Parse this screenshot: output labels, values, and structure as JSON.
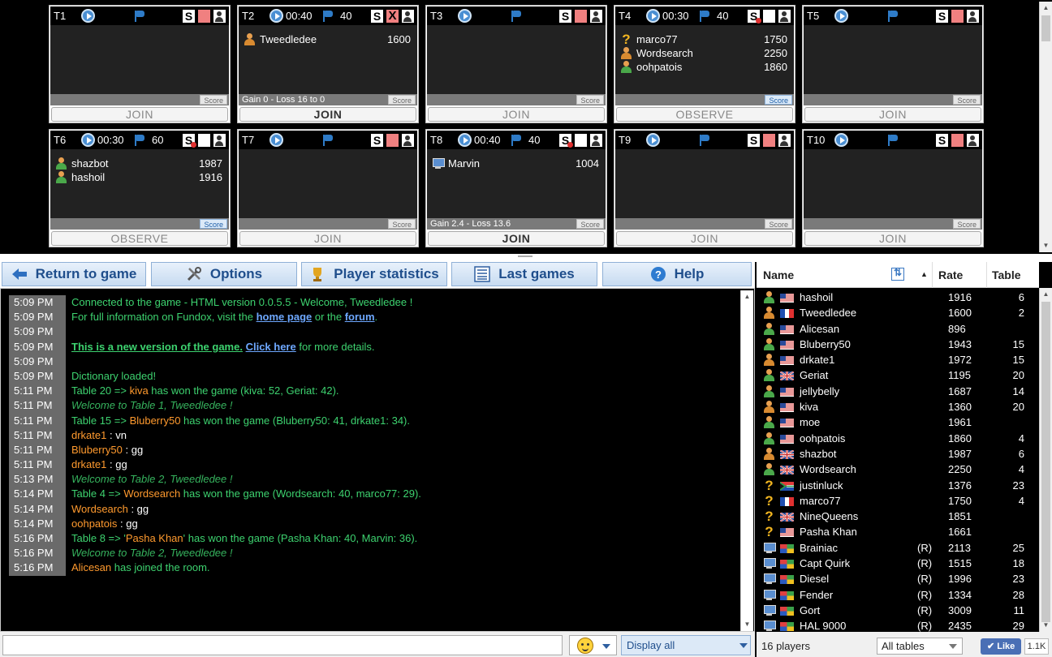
{
  "colors": {
    "accent": "#1f4e8c",
    "chat_green": "#3dd26f",
    "username_orange": "#ff9a2e",
    "link_blue": "#6ea8ff"
  },
  "tables": [
    {
      "name": "T1",
      "time": "",
      "points": "",
      "x_icon": false,
      "players": [],
      "footer": "",
      "score_label": "Score",
      "score_active": false,
      "button": "JOIN",
      "button_strong": false
    },
    {
      "name": "T2",
      "time": "00:40",
      "points": "40",
      "x_icon": true,
      "players": [
        {
          "name": "Tweedledee",
          "rating": "1600",
          "icon": "human"
        }
      ],
      "footer": "Gain 0 - Loss 16 to 0",
      "score_label": "Score",
      "score_active": false,
      "button": "JOIN",
      "button_strong": true
    },
    {
      "name": "T3",
      "time": "",
      "points": "",
      "x_icon": false,
      "players": [],
      "footer": "",
      "score_label": "Score",
      "score_active": false,
      "button": "JOIN",
      "button_strong": false
    },
    {
      "name": "T4",
      "time": "00:30",
      "points": "40",
      "x_icon": false,
      "s_crossed": true,
      "white_sq": true,
      "players": [
        {
          "name": "marco77",
          "rating": "1750",
          "icon": "question"
        },
        {
          "name": "Wordsearch",
          "rating": "2250",
          "icon": "human"
        },
        {
          "name": "oohpatois",
          "rating": "1860",
          "icon": "human"
        }
      ],
      "footer": "",
      "score_label": "Score",
      "score_active": true,
      "button": "OBSERVE",
      "button_strong": false
    },
    {
      "name": "T5",
      "time": "",
      "points": "",
      "x_icon": false,
      "players": [],
      "footer": "",
      "score_label": "Score",
      "score_active": false,
      "button": "JOIN",
      "button_strong": false
    },
    {
      "name": "T6",
      "time": "00:30",
      "points": "60",
      "x_icon": false,
      "s_crossed": true,
      "white_sq": true,
      "players": [
        {
          "name": "shazbot",
          "rating": "1987",
          "icon": "human"
        },
        {
          "name": "hashoil",
          "rating": "1916",
          "icon": "human"
        }
      ],
      "footer": "",
      "score_label": "Score",
      "score_active": true,
      "button": "OBSERVE",
      "button_strong": false
    },
    {
      "name": "T7",
      "time": "",
      "points": "",
      "x_icon": false,
      "players": [],
      "footer": "",
      "score_label": "Score",
      "score_active": false,
      "button": "JOIN",
      "button_strong": false
    },
    {
      "name": "T8",
      "time": "00:40",
      "points": "40",
      "x_icon": false,
      "s_crossed": true,
      "white_sq": true,
      "players": [
        {
          "name": "Marvin",
          "rating": "1004",
          "icon": "computer"
        }
      ],
      "footer": "Gain 2.4 - Loss 13.6",
      "score_label": "Score",
      "score_active": false,
      "button": "JOIN",
      "button_strong": true
    },
    {
      "name": "T9",
      "time": "",
      "points": "",
      "x_icon": false,
      "players": [],
      "footer": "",
      "score_label": "Score",
      "score_active": false,
      "button": "JOIN",
      "button_strong": false
    },
    {
      "name": "T10",
      "time": "",
      "points": "",
      "x_icon": false,
      "players": [],
      "footer": "",
      "score_label": "Score",
      "score_active": false,
      "button": "JOIN",
      "button_strong": false
    }
  ],
  "toolbar": {
    "return_label": "Return to game",
    "options_label": "Options",
    "stats_label": "Player statistics",
    "last_games_label": "Last games",
    "help_label": "Help"
  },
  "chat": [
    {
      "time": "5:09 PM",
      "parts": [
        {
          "t": "Connected to the game - HTML version 0.0.5.5 - Welcome, Tweedledee !",
          "c": ""
        }
      ]
    },
    {
      "time": "5:09 PM",
      "parts": [
        {
          "t": "For full information on Fundox, visit the ",
          "c": ""
        },
        {
          "t": "home page",
          "c": "lnk"
        },
        {
          "t": " or the ",
          "c": ""
        },
        {
          "t": "forum",
          "c": "lnk"
        },
        {
          "t": ".",
          "c": ""
        }
      ]
    },
    {
      "time": "5:09 PM",
      "parts": []
    },
    {
      "time": "5:09 PM",
      "parts": [
        {
          "t": "This is a new version of the game.",
          "c": "bold-u"
        },
        {
          "t": " ",
          "c": ""
        },
        {
          "t": "Click here",
          "c": "lnk"
        },
        {
          "t": " for more details.",
          "c": ""
        }
      ]
    },
    {
      "time": "5:09 PM",
      "parts": []
    },
    {
      "time": "5:09 PM",
      "parts": [
        {
          "t": "Dictionary loaded!",
          "c": ""
        }
      ]
    },
    {
      "time": "5:11 PM",
      "parts": [
        {
          "t": "Table 20 => ",
          "c": ""
        },
        {
          "t": "kiva",
          "c": "u"
        },
        {
          "t": " has won the game (kiva: 52, Geriat: 42).",
          "c": ""
        }
      ]
    },
    {
      "time": "5:11 PM",
      "parts": [
        {
          "t": "Welcome to Table 1, Tweedledee !",
          "c": "ital"
        }
      ]
    },
    {
      "time": "5:11 PM",
      "parts": [
        {
          "t": "Table 15 => ",
          "c": ""
        },
        {
          "t": "Bluberry50",
          "c": "u"
        },
        {
          "t": " has won the game (Bluberry50: 41, drkate1: 34).",
          "c": ""
        }
      ]
    },
    {
      "time": "5:11 PM",
      "parts": [
        {
          "t": "drkate1",
          "c": "u"
        },
        {
          "t": " : vn",
          "c": "w"
        }
      ]
    },
    {
      "time": "5:11 PM",
      "parts": [
        {
          "t": "Bluberry50",
          "c": "u"
        },
        {
          "t": " : gg",
          "c": "w"
        }
      ]
    },
    {
      "time": "5:11 PM",
      "parts": [
        {
          "t": "drkate1",
          "c": "u"
        },
        {
          "t": " : gg",
          "c": "w"
        }
      ]
    },
    {
      "time": "5:13 PM",
      "parts": [
        {
          "t": "Welcome to Table 2, Tweedledee !",
          "c": "ital"
        }
      ]
    },
    {
      "time": "5:14 PM",
      "parts": [
        {
          "t": "Table 4 => ",
          "c": ""
        },
        {
          "t": "Wordsearch",
          "c": "u"
        },
        {
          "t": " has won the game (Wordsearch: 40, marco77: 29).",
          "c": ""
        }
      ]
    },
    {
      "time": "5:14 PM",
      "parts": [
        {
          "t": "Wordsearch",
          "c": "u"
        },
        {
          "t": " : gg",
          "c": "w"
        }
      ]
    },
    {
      "time": "5:14 PM",
      "parts": [
        {
          "t": "oohpatois",
          "c": "u"
        },
        {
          "t": " : gg",
          "c": "w"
        }
      ]
    },
    {
      "time": "5:16 PM",
      "parts": [
        {
          "t": "Table 8 => '",
          "c": ""
        },
        {
          "t": "Pasha Khan",
          "c": "u"
        },
        {
          "t": "' has won the game (Pasha Khan: 40, Marvin: 36).",
          "c": ""
        }
      ]
    },
    {
      "time": "5:16 PM",
      "parts": [
        {
          "t": "Welcome to Table 2, Tweedledee !",
          "c": "ital"
        }
      ]
    },
    {
      "time": "5:16 PM",
      "parts": [
        {
          "t": "Alicesan",
          "c": "u"
        },
        {
          "t": " has joined the room.",
          "c": ""
        }
      ]
    }
  ],
  "input": {
    "value": "",
    "placeholder": ""
  },
  "display_select": "Display all",
  "players_panel": {
    "col_name": "Name",
    "col_rate": "Rate",
    "col_table": "Table",
    "count_label": "16 players",
    "tables_select": "All tables",
    "like_label": "Like",
    "like_count": "1.1K",
    "rows": [
      {
        "name": "hashoil",
        "flag": "us",
        "icon": "human",
        "robot": "",
        "rate": "1916",
        "table": "6"
      },
      {
        "name": "Tweedledee",
        "flag": "fr",
        "icon": "human",
        "robot": "",
        "rate": "1600",
        "table": "2"
      },
      {
        "name": "Alicesan",
        "flag": "us",
        "icon": "human",
        "robot": "",
        "rate": "896",
        "table": ""
      },
      {
        "name": "Bluberry50",
        "flag": "us",
        "icon": "human",
        "robot": "",
        "rate": "1943",
        "table": "15"
      },
      {
        "name": "drkate1",
        "flag": "us",
        "icon": "human",
        "robot": "",
        "rate": "1972",
        "table": "15"
      },
      {
        "name": "Geriat",
        "flag": "uk",
        "icon": "human",
        "robot": "",
        "rate": "1195",
        "table": "20"
      },
      {
        "name": "jellybelly",
        "flag": "us",
        "icon": "human",
        "robot": "",
        "rate": "1687",
        "table": "14"
      },
      {
        "name": "kiva",
        "flag": "us",
        "icon": "human",
        "robot": "",
        "rate": "1360",
        "table": "20"
      },
      {
        "name": "moe",
        "flag": "us",
        "icon": "human",
        "robot": "",
        "rate": "1961",
        "table": ""
      },
      {
        "name": "oohpatois",
        "flag": "us",
        "icon": "human",
        "robot": "",
        "rate": "1860",
        "table": "4"
      },
      {
        "name": "shazbot",
        "flag": "uk",
        "icon": "human",
        "robot": "",
        "rate": "1987",
        "table": "6"
      },
      {
        "name": "Wordsearch",
        "flag": "uk",
        "icon": "human",
        "robot": "",
        "rate": "2250",
        "table": "4"
      },
      {
        "name": "justinluck",
        "flag": "za",
        "icon": "question",
        "robot": "",
        "rate": "1376",
        "table": "23"
      },
      {
        "name": "marco77",
        "flag": "fr",
        "icon": "question",
        "robot": "",
        "rate": "1750",
        "table": "4"
      },
      {
        "name": "NineQueens",
        "flag": "uk",
        "icon": "question",
        "robot": "",
        "rate": "1851",
        "table": ""
      },
      {
        "name": "Pasha Khan",
        "flag": "us",
        "icon": "question",
        "robot": "",
        "rate": "1661",
        "table": ""
      },
      {
        "name": "Brainiac",
        "flag": "multi",
        "icon": "computer",
        "robot": "(R)",
        "rate": "2113",
        "table": "25"
      },
      {
        "name": "Capt Quirk",
        "flag": "multi",
        "icon": "computer",
        "robot": "(R)",
        "rate": "1515",
        "table": "18"
      },
      {
        "name": "Diesel",
        "flag": "multi",
        "icon": "computer",
        "robot": "(R)",
        "rate": "1996",
        "table": "23"
      },
      {
        "name": "Fender",
        "flag": "multi",
        "icon": "computer",
        "robot": "(R)",
        "rate": "1334",
        "table": "28"
      },
      {
        "name": "Gort",
        "flag": "multi",
        "icon": "computer",
        "robot": "(R)",
        "rate": "3009",
        "table": "11"
      },
      {
        "name": "HAL 9000",
        "flag": "multi",
        "icon": "computer",
        "robot": "(R)",
        "rate": "2435",
        "table": "29"
      }
    ]
  }
}
